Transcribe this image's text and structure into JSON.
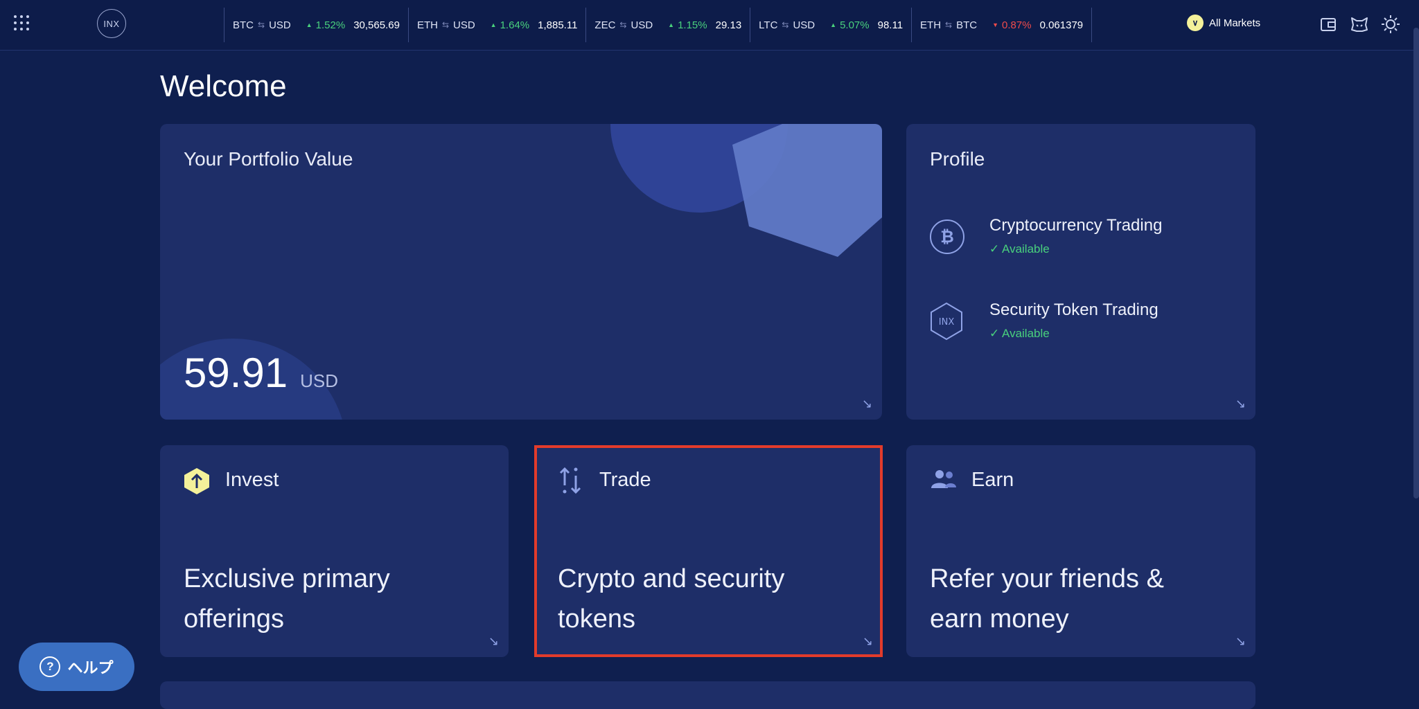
{
  "header": {
    "logo_text": "INX",
    "ticker": [
      {
        "base": "BTC",
        "quote": "USD",
        "direction": "up",
        "change": "1.52%",
        "price": "30,565.69"
      },
      {
        "base": "ETH",
        "quote": "USD",
        "direction": "up",
        "change": "1.64%",
        "price": "1,885.11"
      },
      {
        "base": "ZEC",
        "quote": "USD",
        "direction": "up",
        "change": "1.15%",
        "price": "29.13"
      },
      {
        "base": "LTC",
        "quote": "USD",
        "direction": "up",
        "change": "5.07%",
        "price": "98.11"
      },
      {
        "base": "ETH",
        "quote": "BTC",
        "direction": "down",
        "change": "0.87%",
        "price": "0.061379"
      }
    ],
    "markets_label": "All Markets"
  },
  "page": {
    "title": "Welcome"
  },
  "portfolio": {
    "title": "Your Portfolio Value",
    "value": "59.91",
    "currency": "USD"
  },
  "profile": {
    "title": "Profile",
    "items": [
      {
        "label": "Cryptocurrency Trading",
        "status": "Available"
      },
      {
        "label": "Security Token Trading",
        "status": "Available"
      }
    ]
  },
  "cards": {
    "invest": {
      "title": "Invest",
      "line1": "Exclusive primary",
      "line2": "offerings"
    },
    "trade": {
      "title": "Trade",
      "line1": "Crypto and security",
      "line2": "tokens"
    },
    "earn": {
      "title": "Earn",
      "line1": "Refer your friends &",
      "line2": "earn money"
    }
  },
  "help": {
    "label": "ヘルプ"
  },
  "colors": {
    "background": "#0f1f4f",
    "card": "#1e2e68",
    "up": "#49d17d",
    "down": "#ef4b4b",
    "highlight": "#e23b2b"
  }
}
